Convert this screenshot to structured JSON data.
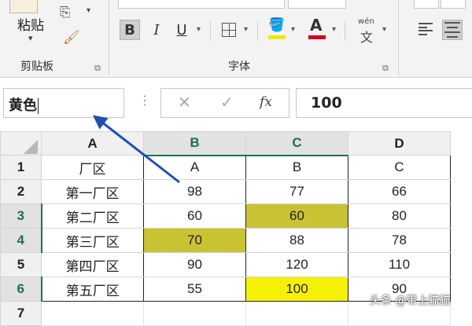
{
  "ribbon": {
    "clipboard": {
      "paste_label": "粘贴",
      "group_label": "剪贴板"
    },
    "font": {
      "group_label": "字体",
      "bold": "B",
      "italic": "I",
      "underline": "U",
      "font_color_letter": "A",
      "wen_top": "wén",
      "wen_bottom": "文",
      "fill_color": "#f2e600",
      "font_color": "#d0021b"
    }
  },
  "formula_bar": {
    "name_box_value": "黄色",
    "fx_label": "fx",
    "formula_value": "100"
  },
  "sheet": {
    "columns": [
      "A",
      "B",
      "C",
      "D"
    ],
    "rows": [
      {
        "num": "1",
        "cells": [
          "厂区",
          "A",
          "B",
          "C"
        ]
      },
      {
        "num": "2",
        "cells": [
          "第一厂区",
          "98",
          "77",
          "66"
        ]
      },
      {
        "num": "3",
        "cells": [
          "第二厂区",
          "60",
          "60",
          "80"
        ]
      },
      {
        "num": "4",
        "cells": [
          "第三厂区",
          "70",
          "88",
          "78"
        ]
      },
      {
        "num": "5",
        "cells": [
          "第四厂区",
          "90",
          "120",
          "110"
        ]
      },
      {
        "num": "6",
        "cells": [
          "第五厂区",
          "55",
          "100",
          "90"
        ]
      },
      {
        "num": "7",
        "cells": [
          "",
          "",
          "",
          ""
        ]
      }
    ],
    "highlight_colors": {
      "olive": "#c9c233",
      "yellow": "#f5f106"
    }
  },
  "annotation": {
    "arrow_color": "#1f4fb0"
  },
  "watermark": "头条 @带上猫猫"
}
